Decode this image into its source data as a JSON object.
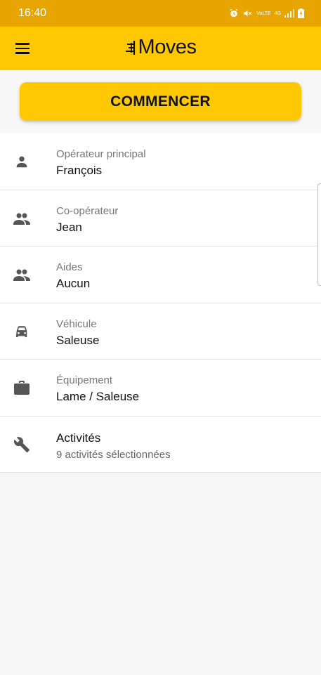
{
  "status_bar": {
    "time": "16:40",
    "icons": [
      "alarm-icon",
      "mute-icon",
      "volte-icon",
      "4g-icon",
      "signal-icon",
      "battery-icon"
    ],
    "volte_label": "VoLTE",
    "network_label": "4G"
  },
  "app_bar": {
    "logo_text": "Moves",
    "menu_icon": "hamburger-menu-icon"
  },
  "start_button": {
    "label": "COMMENCER"
  },
  "colors": {
    "accent": "#ffc800",
    "status_bar": "#e8a500"
  },
  "rows": [
    {
      "icon": "person-icon",
      "label": "Opérateur principal",
      "value": "François"
    },
    {
      "icon": "people-icon",
      "label": "Co-opérateur",
      "value": "Jean"
    },
    {
      "icon": "people-icon",
      "label": "Aides",
      "value": "Aucun"
    },
    {
      "icon": "car-icon",
      "label": "Véhicule",
      "value": "Saleuse"
    },
    {
      "icon": "briefcase-icon",
      "label": "Équipement",
      "value": "Lame / Saleuse"
    }
  ],
  "activities": {
    "icon": "wrench-icon",
    "title": "Activités",
    "subtitle": "9 activités sélectionnées"
  }
}
